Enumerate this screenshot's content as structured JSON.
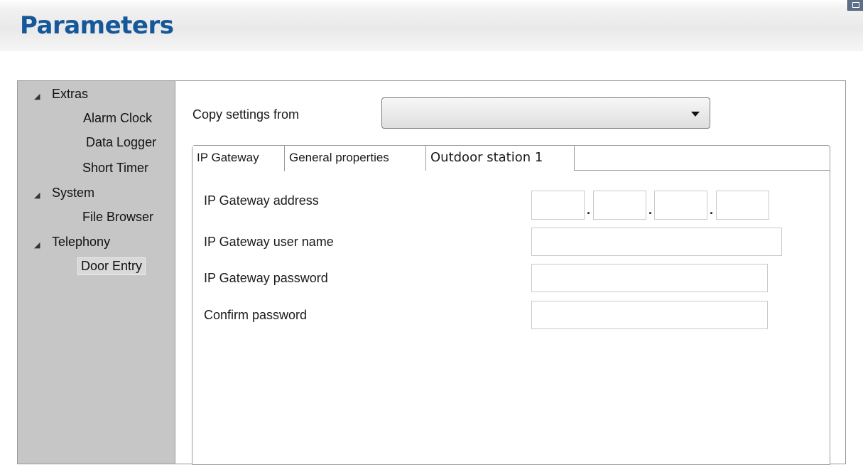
{
  "header": {
    "title": "Parameters"
  },
  "tree": {
    "groups": [
      {
        "label": "Extras",
        "items": [
          "Alarm Clock",
          "Data Logger",
          "Short Timer"
        ]
      },
      {
        "label": "System",
        "items": [
          "File Browser"
        ]
      },
      {
        "label": "Telephony",
        "items": [
          "Door Entry"
        ]
      }
    ],
    "selected": "Door Entry"
  },
  "main": {
    "copy_settings": {
      "label": "Copy settings from",
      "selected_value": ""
    },
    "tabs": [
      {
        "label": "IP Gateway",
        "active": true
      },
      {
        "label": "General properties",
        "active": false
      },
      {
        "label": "Outdoor station 1",
        "active": false
      }
    ],
    "form": {
      "address_label": "IP Gateway address",
      "address_octets": [
        "",
        "",
        "",
        ""
      ],
      "address_separator": ".",
      "user_label": "IP Gateway user name",
      "user_value": "",
      "password_label": "IP Gateway password",
      "password_value": "",
      "confirm_label": "Confirm password",
      "confirm_value": ""
    }
  },
  "icons": {
    "collapse": "collapse-triangle-icon",
    "dropdown": "chevron-down-icon",
    "window": "window-icon"
  },
  "colors": {
    "title": "#15589a",
    "tree_background": "#c6c6c6"
  }
}
